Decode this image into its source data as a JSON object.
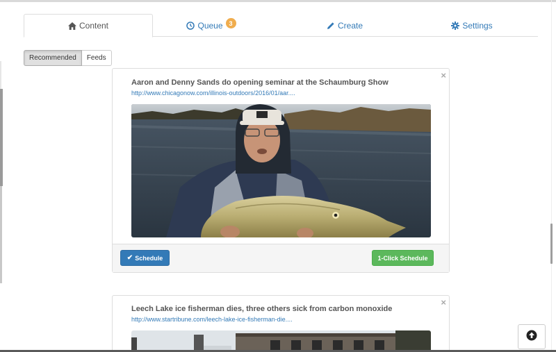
{
  "tabs": [
    {
      "label": "Content",
      "icon": "home-icon"
    },
    {
      "label": "Queue",
      "icon": "clock-icon",
      "badge": "3"
    },
    {
      "label": "Create",
      "icon": "pencil-icon"
    },
    {
      "label": "Settings",
      "icon": "gear-icon"
    }
  ],
  "filters": {
    "recommended_label": "Recommended",
    "feeds_label": "Feeds",
    "selected": "Recommended"
  },
  "cards": [
    {
      "title": "Aaron and Denny Sands do opening seminar at the Schaumburg Show",
      "link": "http://www.chicagonow.com/illinois-outdoors/2016/01/aar....",
      "close_symbol": "×",
      "schedule_label": "Schedule",
      "one_click_label": "1-Click Schedule"
    },
    {
      "title": "Leech Lake ice fisherman dies, three others sick from carbon monoxide",
      "link": "http://www.startribune.com/leech-lake-ice-fisherman-die....",
      "close_symbol": "×"
    }
  ],
  "colors": {
    "link": "#337ab7",
    "badge": "#f0ad4e",
    "primary_button": "#337ab7",
    "success_button": "#5cb85c"
  }
}
